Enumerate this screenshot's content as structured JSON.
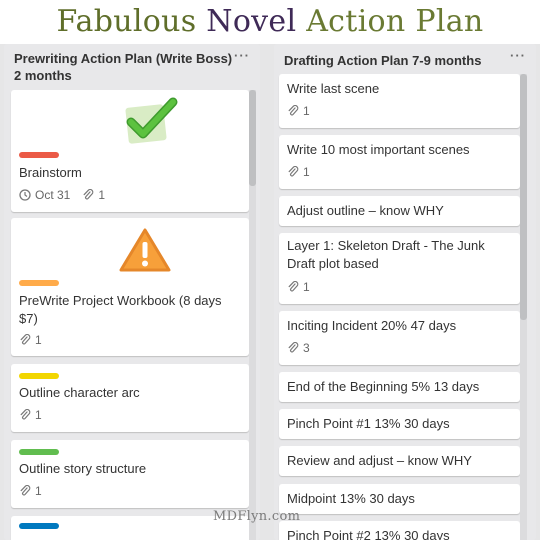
{
  "header": {
    "title_part1": "Fabulous",
    "title_part2": "Novel",
    "title_part3": "Action Plan"
  },
  "lists": {
    "prewriting": {
      "title": "Prewriting Action Plan (Write Boss) 2 months",
      "menu": "···",
      "cards": [
        {
          "title": "Brainstorm",
          "label_color": "#eb5a46",
          "cover": "green-checkmark-icon",
          "due": "Oct 31",
          "attachments": "1"
        },
        {
          "title": "PreWrite Project Workbook (8 days $7)",
          "label_color": "#ffab4a",
          "cover": "orange-warning-icon",
          "attachments": "1"
        },
        {
          "title": "Outline character arc",
          "label_color": "#f2d600",
          "attachments": "1"
        },
        {
          "title": "Outline story structure",
          "label_color": "#61bd4f",
          "attachments": "1"
        },
        {
          "title": "",
          "label_color": "#0079bf"
        }
      ]
    },
    "drafting": {
      "title": "Drafting Action Plan 7-9 months",
      "menu": "···",
      "cards": [
        {
          "title": "Write last scene",
          "attachments": "1"
        },
        {
          "title": "Write 10 most important scenes",
          "attachments": "1"
        },
        {
          "title": "Adjust outline – know WHY"
        },
        {
          "title": "Layer 1: Skeleton Draft - The Junk Draft plot based",
          "attachments": "1"
        },
        {
          "title": "Inciting Incident 20% 47 days",
          "attachments": "3"
        },
        {
          "title": "End of the Beginning 5% 13 days"
        },
        {
          "title": "Pinch Point #1 13% 30 days"
        },
        {
          "title": "Review and adjust – know WHY"
        },
        {
          "title": "Midpoint 13% 30 days"
        },
        {
          "title": "Pinch Point #2 13% 30 days"
        }
      ]
    }
  },
  "watermark": "MDFlyn.com"
}
